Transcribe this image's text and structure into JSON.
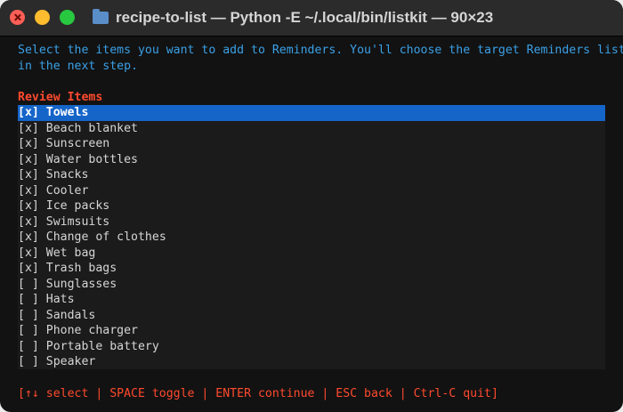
{
  "window": {
    "title": "recipe-to-list — Python -E ~/.local/bin/listkit — 90×23",
    "title_icon": "folder-icon"
  },
  "intro": {
    "line1": "Select the items you want to add to Reminders. You'll choose the target Reminders list",
    "line2": "in the next step."
  },
  "list": {
    "heading": "Review Items",
    "items": [
      {
        "mark": "[x]",
        "label": "Towels",
        "selected": true
      },
      {
        "mark": "[x]",
        "label": "Beach blanket"
      },
      {
        "mark": "[x]",
        "label": "Sunscreen"
      },
      {
        "mark": "[x]",
        "label": "Water bottles"
      },
      {
        "mark": "[x]",
        "label": "Snacks"
      },
      {
        "mark": "[x]",
        "label": "Cooler"
      },
      {
        "mark": "[x]",
        "label": "Ice packs"
      },
      {
        "mark": "[x]",
        "label": "Swimsuits"
      },
      {
        "mark": "[x]",
        "label": "Change of clothes"
      },
      {
        "mark": "[x]",
        "label": "Wet bag"
      },
      {
        "mark": "[x]",
        "label": "Trash bags"
      },
      {
        "mark": "[ ]",
        "label": "Sunglasses"
      },
      {
        "mark": "[ ]",
        "label": "Hats"
      },
      {
        "mark": "[ ]",
        "label": "Sandals"
      },
      {
        "mark": "[ ]",
        "label": "Phone charger"
      },
      {
        "mark": "[ ]",
        "label": "Portable battery"
      },
      {
        "mark": "[ ]",
        "label": "Speaker"
      }
    ]
  },
  "footer": {
    "help": "[↑↓ select | SPACE toggle | ENTER continue | ESC back | Ctrl-C quit]"
  },
  "colors": {
    "accent_blue": "#3aa0e6",
    "heading_red": "#ff4a2e",
    "selection_bg": "#1565c9"
  }
}
